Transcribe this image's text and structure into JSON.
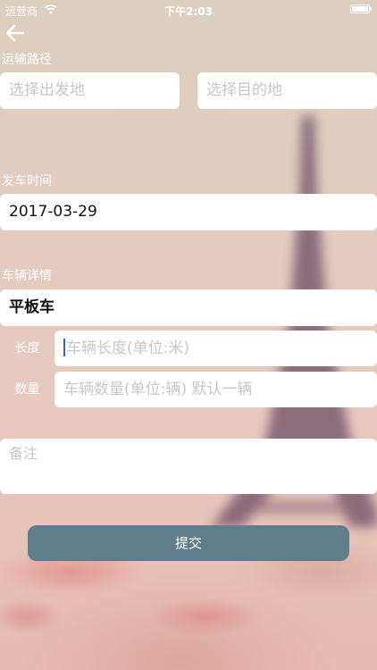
{
  "status_bar": {
    "carrier": "运营商",
    "time": "下午2:03"
  },
  "icons": {
    "back": "arrow-left-icon",
    "wifi": "wifi-icon",
    "battery": "battery-icon"
  },
  "colors": {
    "submit_button": "#5f7d8b",
    "field_background": "#ffffff",
    "placeholder": "#c7c7cd",
    "caret": "#2f63d7"
  },
  "route": {
    "label": "运输路径",
    "origin_placeholder": "选择出发地",
    "destination_placeholder": "选择目的地"
  },
  "departure": {
    "label": "发车时间",
    "date": "2017-03-29"
  },
  "vehicle": {
    "label": "车辆详情",
    "type": "平板车",
    "length_label": "长度",
    "length_placeholder": "车辆长度(单位:米)",
    "count_label": "数量",
    "count_placeholder": "车辆数量(单位:辆) 默认一辆"
  },
  "notes": {
    "placeholder": "备注"
  },
  "submit": {
    "label": "提交"
  }
}
